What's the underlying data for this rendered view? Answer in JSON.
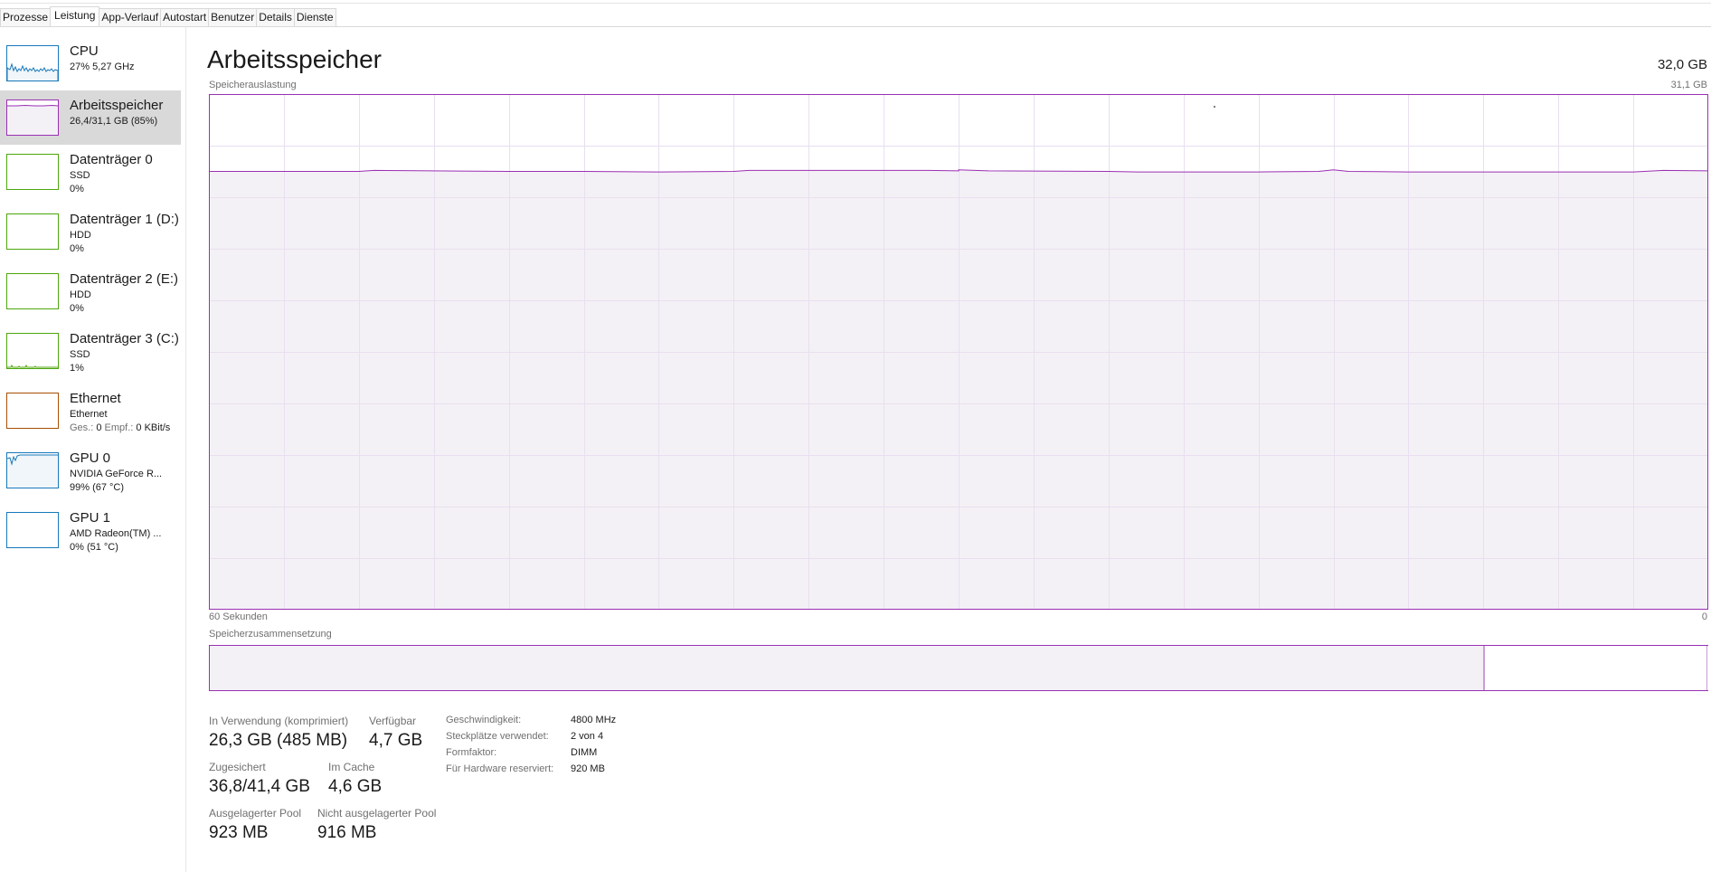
{
  "tabs": [
    "Prozesse",
    "Leistung",
    "App-Verlauf",
    "Autostart",
    "Benutzer",
    "Details",
    "Dienste"
  ],
  "active_tab": "Leistung",
  "sidebar": {
    "items": [
      {
        "title": "CPU",
        "line1": "27%  5,27 GHz",
        "line2": "",
        "color": "#1779ba"
      },
      {
        "title": "Arbeitsspeicher",
        "line1": "26,4/31,1 GB (85%)",
        "line2": "",
        "color": "#9a30b3"
      },
      {
        "title": "Datenträger 0",
        "line1": "SSD",
        "line2": "0%",
        "color": "#4da60c"
      },
      {
        "title": "Datenträger 1 (D:)",
        "line1": "HDD",
        "line2": "0%",
        "color": "#4da60c"
      },
      {
        "title": "Datenträger 2 (E:)",
        "line1": "HDD",
        "line2": "0%",
        "color": "#4da60c"
      },
      {
        "title": "Datenträger 3 (C:)",
        "line1": "SSD",
        "line2": "1%",
        "color": "#4da60c"
      },
      {
        "title": "Ethernet",
        "line1": "Ethernet",
        "line2_label1": "Ges.:",
        "line2_val1": "0",
        "line2_label2": "Empf.:",
        "line2_val2": "0 KBit/s",
        "color": "#a74f01"
      },
      {
        "title": "GPU 0",
        "line1": "NVIDIA GeForce R...",
        "line2": "99%  (67 °C)",
        "color": "#1779ba"
      },
      {
        "title": "GPU 1",
        "line1": "AMD Radeon(TM) ...",
        "line2": "0%  (51 °C)",
        "color": "#1779ba"
      }
    ]
  },
  "main": {
    "title": "Arbeitsspeicher",
    "capacity": "32,0 GB",
    "graph_label": "Speicherauslastung",
    "graph_max": "31,1 GB",
    "axis_left": "60 Sekunden",
    "axis_right": "0",
    "composition_label": "Speicherzusammensetzung",
    "composition": {
      "in_use_fraction": 0.85,
      "standby_fraction": 0.148,
      "free_fraction": 0.002
    },
    "usage_fraction": 0.85,
    "stats": {
      "in_use_label": "In Verwendung (komprimiert)",
      "in_use_value": "26,3 GB (485 MB)",
      "available_label": "Verfügbar",
      "available_value": "4,7 GB",
      "committed_label": "Zugesichert",
      "committed_value": "36,8/41,4 GB",
      "cached_label": "Im Cache",
      "cached_value": "4,6 GB",
      "paged_label": "Ausgelagerter Pool",
      "paged_value": "923 MB",
      "nonpaged_label": "Nicht ausgelagerter Pool",
      "nonpaged_value": "916 MB"
    },
    "specs": {
      "speed_label": "Geschwindigkeit:",
      "speed_value": "4800 MHz",
      "slots_label": "Steckplätze verwendet:",
      "slots_value": "2 von 4",
      "form_label": "Formfaktor:",
      "form_value": "DIMM",
      "reserved_label": "Für Hardware reserviert:",
      "reserved_value": "920 MB"
    }
  },
  "colors": {
    "memory": "#9a30b3",
    "memory_fill": "#f4f1f6",
    "grid": "#e8dff0"
  }
}
